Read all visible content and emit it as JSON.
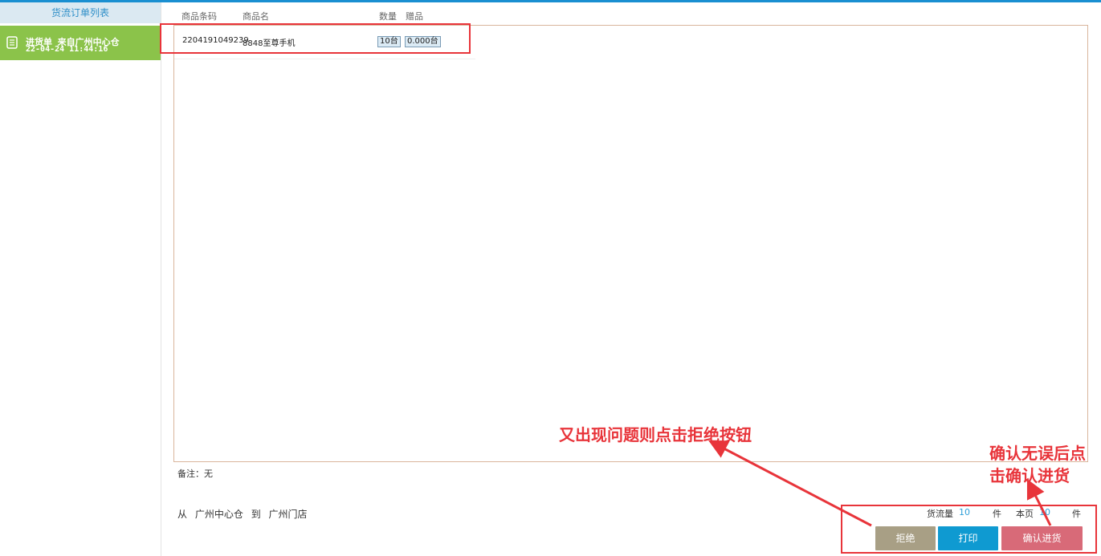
{
  "sidebar": {
    "header": "货流订单列表",
    "orders": [
      {
        "title": "进货单 来自广州中心仓",
        "time": "22-04-24 11:44:16"
      }
    ]
  },
  "table": {
    "columns": {
      "barcode": "商品条码",
      "name": "商品名",
      "qty": "数量",
      "gift": "赠品"
    },
    "rows": [
      {
        "barcode": "2204191049239",
        "name": "8848至尊手机",
        "qty": "10台",
        "gift": "0.000台"
      }
    ]
  },
  "remark": "备注：无",
  "route": {
    "from_label": "从",
    "from": "广州中心仓",
    "to_label": "到",
    "to": "广州门店"
  },
  "stats": {
    "flow_label": "货流量",
    "flow_value": "10",
    "flow_unit": "件",
    "page_label": "本页",
    "page_value": "10",
    "page_unit": "件"
  },
  "buttons": {
    "reject": "拒绝",
    "print": "打印",
    "confirm": "确认进货"
  },
  "annotations": {
    "reject_hint": "又出现问题则点击拒绝按钮",
    "confirm_hint_line1": "确认无误后点",
    "confirm_hint_line2": "击确认进货"
  },
  "colors": {
    "accent": "#1a8fd1",
    "order_selected": "#8bc34a",
    "reject": "#a89f85",
    "print": "#0f9ad1",
    "confirm": "#d86a78",
    "annotation": "#e8343a"
  }
}
